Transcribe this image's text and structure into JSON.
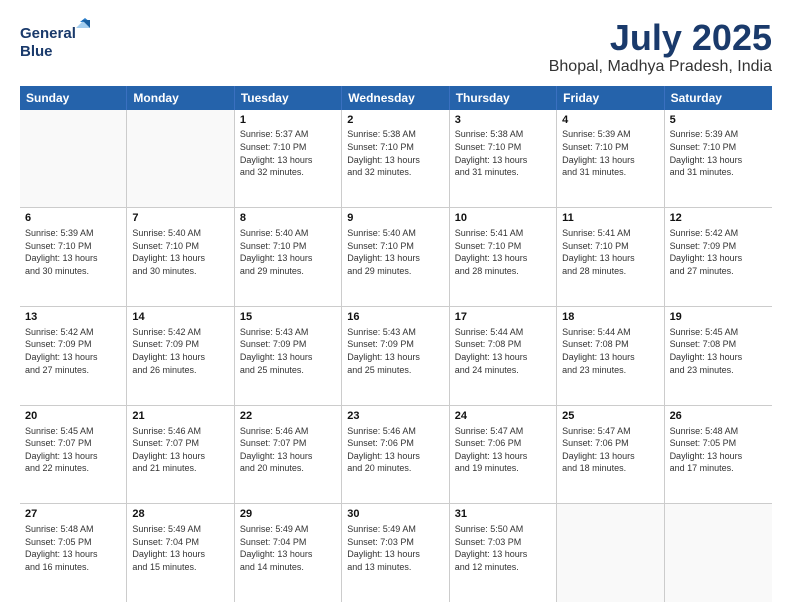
{
  "header": {
    "logo_line1": "General",
    "logo_line2": "Blue",
    "title": "July 2025",
    "subtitle": "Bhopal, Madhya Pradesh, India"
  },
  "calendar": {
    "days_of_week": [
      "Sunday",
      "Monday",
      "Tuesday",
      "Wednesday",
      "Thursday",
      "Friday",
      "Saturday"
    ],
    "rows": [
      [
        {
          "day": "",
          "info": ""
        },
        {
          "day": "",
          "info": ""
        },
        {
          "day": "1",
          "info": "Sunrise: 5:37 AM\nSunset: 7:10 PM\nDaylight: 13 hours\nand 32 minutes."
        },
        {
          "day": "2",
          "info": "Sunrise: 5:38 AM\nSunset: 7:10 PM\nDaylight: 13 hours\nand 32 minutes."
        },
        {
          "day": "3",
          "info": "Sunrise: 5:38 AM\nSunset: 7:10 PM\nDaylight: 13 hours\nand 31 minutes."
        },
        {
          "day": "4",
          "info": "Sunrise: 5:39 AM\nSunset: 7:10 PM\nDaylight: 13 hours\nand 31 minutes."
        },
        {
          "day": "5",
          "info": "Sunrise: 5:39 AM\nSunset: 7:10 PM\nDaylight: 13 hours\nand 31 minutes."
        }
      ],
      [
        {
          "day": "6",
          "info": "Sunrise: 5:39 AM\nSunset: 7:10 PM\nDaylight: 13 hours\nand 30 minutes."
        },
        {
          "day": "7",
          "info": "Sunrise: 5:40 AM\nSunset: 7:10 PM\nDaylight: 13 hours\nand 30 minutes."
        },
        {
          "day": "8",
          "info": "Sunrise: 5:40 AM\nSunset: 7:10 PM\nDaylight: 13 hours\nand 29 minutes."
        },
        {
          "day": "9",
          "info": "Sunrise: 5:40 AM\nSunset: 7:10 PM\nDaylight: 13 hours\nand 29 minutes."
        },
        {
          "day": "10",
          "info": "Sunrise: 5:41 AM\nSunset: 7:10 PM\nDaylight: 13 hours\nand 28 minutes."
        },
        {
          "day": "11",
          "info": "Sunrise: 5:41 AM\nSunset: 7:10 PM\nDaylight: 13 hours\nand 28 minutes."
        },
        {
          "day": "12",
          "info": "Sunrise: 5:42 AM\nSunset: 7:09 PM\nDaylight: 13 hours\nand 27 minutes."
        }
      ],
      [
        {
          "day": "13",
          "info": "Sunrise: 5:42 AM\nSunset: 7:09 PM\nDaylight: 13 hours\nand 27 minutes."
        },
        {
          "day": "14",
          "info": "Sunrise: 5:42 AM\nSunset: 7:09 PM\nDaylight: 13 hours\nand 26 minutes."
        },
        {
          "day": "15",
          "info": "Sunrise: 5:43 AM\nSunset: 7:09 PM\nDaylight: 13 hours\nand 25 minutes."
        },
        {
          "day": "16",
          "info": "Sunrise: 5:43 AM\nSunset: 7:09 PM\nDaylight: 13 hours\nand 25 minutes."
        },
        {
          "day": "17",
          "info": "Sunrise: 5:44 AM\nSunset: 7:08 PM\nDaylight: 13 hours\nand 24 minutes."
        },
        {
          "day": "18",
          "info": "Sunrise: 5:44 AM\nSunset: 7:08 PM\nDaylight: 13 hours\nand 23 minutes."
        },
        {
          "day": "19",
          "info": "Sunrise: 5:45 AM\nSunset: 7:08 PM\nDaylight: 13 hours\nand 23 minutes."
        }
      ],
      [
        {
          "day": "20",
          "info": "Sunrise: 5:45 AM\nSunset: 7:07 PM\nDaylight: 13 hours\nand 22 minutes."
        },
        {
          "day": "21",
          "info": "Sunrise: 5:46 AM\nSunset: 7:07 PM\nDaylight: 13 hours\nand 21 minutes."
        },
        {
          "day": "22",
          "info": "Sunrise: 5:46 AM\nSunset: 7:07 PM\nDaylight: 13 hours\nand 20 minutes."
        },
        {
          "day": "23",
          "info": "Sunrise: 5:46 AM\nSunset: 7:06 PM\nDaylight: 13 hours\nand 20 minutes."
        },
        {
          "day": "24",
          "info": "Sunrise: 5:47 AM\nSunset: 7:06 PM\nDaylight: 13 hours\nand 19 minutes."
        },
        {
          "day": "25",
          "info": "Sunrise: 5:47 AM\nSunset: 7:06 PM\nDaylight: 13 hours\nand 18 minutes."
        },
        {
          "day": "26",
          "info": "Sunrise: 5:48 AM\nSunset: 7:05 PM\nDaylight: 13 hours\nand 17 minutes."
        }
      ],
      [
        {
          "day": "27",
          "info": "Sunrise: 5:48 AM\nSunset: 7:05 PM\nDaylight: 13 hours\nand 16 minutes."
        },
        {
          "day": "28",
          "info": "Sunrise: 5:49 AM\nSunset: 7:04 PM\nDaylight: 13 hours\nand 15 minutes."
        },
        {
          "day": "29",
          "info": "Sunrise: 5:49 AM\nSunset: 7:04 PM\nDaylight: 13 hours\nand 14 minutes."
        },
        {
          "day": "30",
          "info": "Sunrise: 5:49 AM\nSunset: 7:03 PM\nDaylight: 13 hours\nand 13 minutes."
        },
        {
          "day": "31",
          "info": "Sunrise: 5:50 AM\nSunset: 7:03 PM\nDaylight: 13 hours\nand 12 minutes."
        },
        {
          "day": "",
          "info": ""
        },
        {
          "day": "",
          "info": ""
        }
      ]
    ]
  }
}
